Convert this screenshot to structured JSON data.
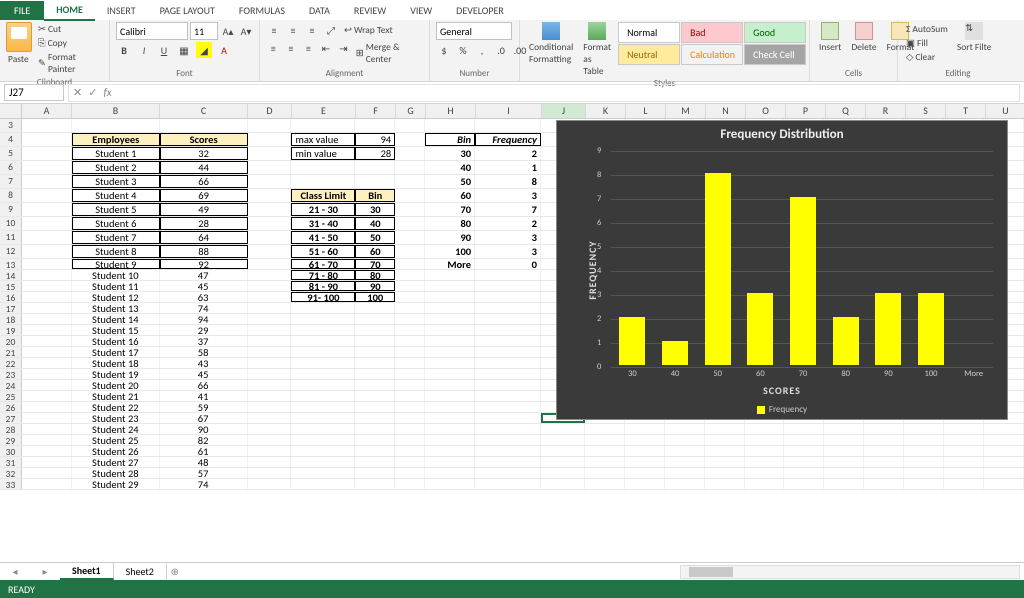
{
  "tabs": {
    "file": "FILE",
    "home": "HOME",
    "insert": "INSERT",
    "page": "PAGE LAYOUT",
    "formulas": "FORMULAS",
    "data": "DATA",
    "review": "REVIEW",
    "view": "VIEW",
    "developer": "DEVELOPER"
  },
  "clipboard": {
    "paste": "Paste",
    "cut": "Cut",
    "copy": "Copy",
    "painter": "Format Painter",
    "label": "Clipboard"
  },
  "font": {
    "name": "Calibri",
    "size": "11",
    "label": "Font"
  },
  "alignment": {
    "wrap": "Wrap Text",
    "merge": "Merge & Center",
    "label": "Alignment"
  },
  "number": {
    "format": "General",
    "label": "Number"
  },
  "styles_group": {
    "cond": "Conditional Formatting",
    "fmt": "Format as Table",
    "normal": "Normal",
    "bad": "Bad",
    "good": "Good",
    "neutral": "Neutral",
    "calc": "Calculation",
    "check": "Check Cell",
    "label": "Styles"
  },
  "cells": {
    "insert": "Insert",
    "delete": "Delete",
    "format": "Format",
    "label": "Cells"
  },
  "editing": {
    "autosum": "AutoSum",
    "fill": "Fill",
    "clear": "Clear",
    "sort": "Sort Filte",
    "label": "Editing"
  },
  "namebox": "J27",
  "fx": "fx",
  "cols": [
    "A",
    "B",
    "C",
    "D",
    "E",
    "F",
    "G",
    "H",
    "I",
    "J",
    "K",
    "L",
    "M",
    "N",
    "O",
    "P",
    "Q",
    "R",
    "S",
    "T",
    "U"
  ],
  "table1_head": {
    "b": "Employees",
    "c": "Scores"
  },
  "table1": [
    {
      "n": 4,
      "b": "Student 1",
      "c": "32"
    },
    {
      "n": 5,
      "b": "Student 2",
      "c": "44"
    },
    {
      "n": 6,
      "b": "Student 3",
      "c": "66"
    },
    {
      "n": 7,
      "b": "Student 4",
      "c": "69"
    },
    {
      "n": 8,
      "b": "Student 5",
      "c": "49"
    },
    {
      "n": 9,
      "b": "Student 6",
      "c": "28"
    },
    {
      "n": 10,
      "b": "Student 7",
      "c": "64"
    },
    {
      "n": 11,
      "b": "Student 8",
      "c": "88"
    },
    {
      "n": 12,
      "b": "Student 9",
      "c": "92"
    },
    {
      "n": 13,
      "b": "Student 10",
      "c": "47"
    },
    {
      "n": 14,
      "b": "Student 11",
      "c": "45"
    },
    {
      "n": 15,
      "b": "Student 12",
      "c": "63"
    },
    {
      "n": 16,
      "b": "Student 13",
      "c": "74"
    },
    {
      "n": 17,
      "b": "Student 14",
      "c": "94"
    },
    {
      "n": 18,
      "b": "Student 15",
      "c": "29"
    },
    {
      "n": 19,
      "b": "Student 16",
      "c": "37"
    },
    {
      "n": 20,
      "b": "Student 17",
      "c": "58"
    },
    {
      "n": 21,
      "b": "Student 18",
      "c": "43"
    },
    {
      "n": 22,
      "b": "Student 19",
      "c": "45"
    },
    {
      "n": 23,
      "b": "Student 20",
      "c": "66"
    },
    {
      "n": 24,
      "b": "Student 21",
      "c": "41"
    },
    {
      "n": 25,
      "b": "Student 22",
      "c": "59"
    },
    {
      "n": 26,
      "b": "Student 23",
      "c": "67"
    },
    {
      "n": 27,
      "b": "Student 24",
      "c": "90"
    },
    {
      "n": 28,
      "b": "Student 25",
      "c": "82"
    },
    {
      "n": 29,
      "b": "Student 26",
      "c": "61"
    },
    {
      "n": 30,
      "b": "Student 27",
      "c": "48"
    },
    {
      "n": 31,
      "b": "Student 28",
      "c": "57"
    },
    {
      "n": 32,
      "b": "Student 29",
      "c": "74"
    }
  ],
  "maxmin": {
    "max_l": "max value",
    "max_v": "94",
    "min_l": "min value",
    "min_v": "28"
  },
  "classlimit": {
    "h1": "Class Limit",
    "h2": "Bin",
    "rows": [
      {
        "e": "21 - 30",
        "f": "30"
      },
      {
        "e": "31 - 40",
        "f": "40"
      },
      {
        "e": "41 - 50",
        "f": "50"
      },
      {
        "e": "51 - 60",
        "f": "60"
      },
      {
        "e": "61 - 70",
        "f": "70"
      },
      {
        "e": "71 - 80",
        "f": "80"
      },
      {
        "e": "81 - 90",
        "f": "90"
      },
      {
        "e": "91- 100",
        "f": "100"
      }
    ]
  },
  "freq": {
    "h1": "Bin",
    "h2": "Frequency",
    "rows": [
      {
        "h": "30",
        "i": "2"
      },
      {
        "h": "40",
        "i": "1"
      },
      {
        "h": "50",
        "i": "8"
      },
      {
        "h": "60",
        "i": "3"
      },
      {
        "h": "70",
        "i": "7"
      },
      {
        "h": "80",
        "i": "2"
      },
      {
        "h": "90",
        "i": "3"
      },
      {
        "h": "100",
        "i": "3"
      },
      {
        "h": "More",
        "i": "0"
      }
    ]
  },
  "chart_data": {
    "type": "bar",
    "title": "Frequency Distribution",
    "xlabel": "SCORES",
    "ylabel": "FREQUENCY",
    "categories": [
      "30",
      "40",
      "50",
      "60",
      "70",
      "80",
      "90",
      "100",
      "More"
    ],
    "values": [
      2,
      1,
      8,
      3,
      7,
      2,
      3,
      3,
      0
    ],
    "series": [
      {
        "name": "Frequency",
        "values": [
          2,
          1,
          8,
          3,
          7,
          2,
          3,
          3,
          0
        ]
      }
    ],
    "yticks": [
      0,
      1,
      2,
      3,
      4,
      5,
      6,
      7,
      8,
      9
    ],
    "ylim": [
      0,
      9
    ],
    "legend": "Frequency"
  },
  "sheets": {
    "s1": "Sheet1",
    "s2": "Sheet2"
  },
  "status": "READY"
}
